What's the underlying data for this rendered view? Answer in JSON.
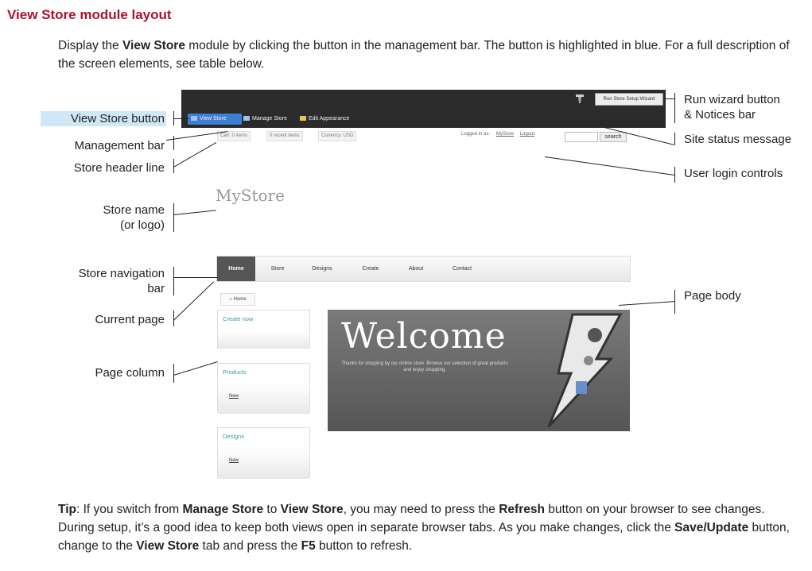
{
  "doc": {
    "title": "View Store module layout",
    "intro": [
      {
        "t": "Display the "
      },
      {
        "t": "View Store",
        "b": true
      },
      {
        "t": " module by clicking the button in the management bar. The button is highlighted in blue. For a full description of the screen elements, see table below."
      }
    ],
    "tip": [
      {
        "t": "Tip",
        "b": true
      },
      {
        "t": ": If you switch from "
      },
      {
        "t": "Manage Store",
        "b": true
      },
      {
        "t": " to "
      },
      {
        "t": "View Store",
        "b": true
      },
      {
        "t": ", you may need to press the "
      },
      {
        "t": "Refresh",
        "b": true
      },
      {
        "t": " button on your browser to see changes. During setup, it’s a good idea to keep both views open in separate browser tabs. As you make changes, click the "
      },
      {
        "t": "Save/Update",
        "b": true
      },
      {
        "t": " button, change to the "
      },
      {
        "t": "View Store",
        "b": true
      },
      {
        "t": " tab and press the "
      },
      {
        "t": "F5",
        "b": true
      },
      {
        "t": " button to refresh."
      }
    ]
  },
  "labels": {
    "view_store_button": "View Store button",
    "management_bar": "Management bar",
    "store_header_line": "Store header line",
    "store_name": "Store name",
    "store_name_2": "(or logo)",
    "store_navigation": "Store navigation",
    "store_navigation_2": "bar",
    "current_page": "Current page",
    "page_column": "Page column",
    "run_wizard": "Run wizard button",
    "run_wizard_2": "& Notices bar",
    "site_status": "Site status message",
    "user_login": "User login controls",
    "page_body": "Page body"
  },
  "mock": {
    "wizard_button": "Run Store Setup Wizard",
    "tabs": {
      "view": "View Store",
      "manage": "Manage Store",
      "edit": "Edit Appearance"
    },
    "header": {
      "cart": "Cart: 0 items",
      "recent": "0 recent items",
      "currency": "Currency: USD"
    },
    "login": {
      "logged_in": "Logged in as:",
      "user": "MyStore",
      "logout": "Logout"
    },
    "search_label": "search",
    "store_name": "MyStore",
    "nav": {
      "home": "Home",
      "store": "Store",
      "designs": "Designs",
      "create": "Create",
      "about": "About",
      "contact": "Contact"
    },
    "breadcrumb": "Home",
    "columns": {
      "create_now": "Create now",
      "products": "Products",
      "products_link": "New",
      "designs": "Designs",
      "designs_link": "New"
    },
    "welcome": "Welcome",
    "welcome_sub": "Thanks for stopping by our online store. Browse our selection of great products and enjoy shopping."
  },
  "colors": {
    "title": "#b0102e",
    "highlight": "#cfe7f7",
    "view_tab": "#3d7fd6",
    "bar": "#2b2b2b"
  }
}
